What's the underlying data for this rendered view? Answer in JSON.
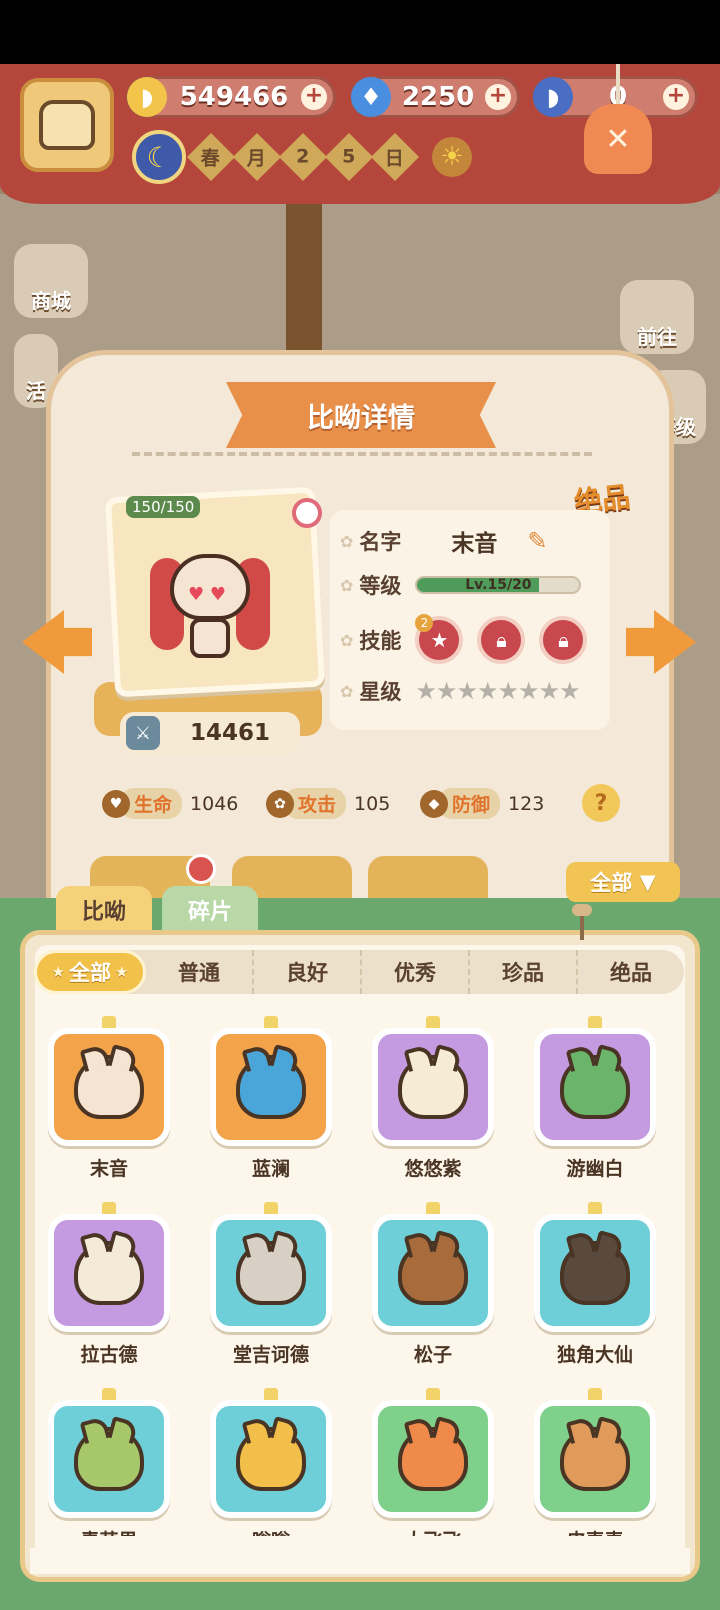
{
  "resources": [
    {
      "icon": "banana-icon",
      "value": "549466",
      "color": "#f2c44a"
    },
    {
      "icon": "blue-flame-icon",
      "value": "2250",
      "color": "#4a8ee0"
    },
    {
      "icon": "blue-banana-icon",
      "value": "0",
      "color": "#4a6ec4"
    }
  ],
  "date": {
    "chars": [
      "春",
      "月",
      "2",
      "5",
      "日"
    ]
  },
  "side_menu": [
    {
      "label": "商城"
    },
    {
      "label": "活"
    },
    {
      "label": "前往"
    },
    {
      "label": "等级"
    }
  ],
  "detail": {
    "title": "比呦详情",
    "quality": "绝品",
    "hp_badge": "150/150",
    "power": "14461",
    "name_label": "名字",
    "name": "末音",
    "level_label": "等级",
    "level_text": "Lv.15/20",
    "level_progress": 0.75,
    "skill_label": "技能",
    "skill_badge": "2",
    "star_label": "星级",
    "stars_total": 8,
    "stats": [
      {
        "icon": "heart-icon",
        "label": "生命",
        "value": "1046"
      },
      {
        "icon": "paw-icon",
        "label": "攻击",
        "value": "105"
      },
      {
        "icon": "shield-icon",
        "label": "防御",
        "value": "123"
      }
    ],
    "help": "?"
  },
  "filter": {
    "label": "全部"
  },
  "tabs": [
    {
      "label": "比呦",
      "active": true
    },
    {
      "label": "碎片",
      "active": false
    }
  ],
  "quality_filters": [
    {
      "label": "全部",
      "active": true
    },
    {
      "label": "普通"
    },
    {
      "label": "良好"
    },
    {
      "label": "优秀"
    },
    {
      "label": "珍品"
    },
    {
      "label": "绝品"
    }
  ],
  "characters": [
    {
      "name": "末音",
      "bg": "#f3a34a",
      "color": "#f6e4d2"
    },
    {
      "name": "蓝澜",
      "bg": "#f3a34a",
      "color": "#4aa6d8"
    },
    {
      "name": "悠悠紫",
      "bg": "#c49ae0",
      "color": "#f6ecd6"
    },
    {
      "name": "游幽白",
      "bg": "#c49ae0",
      "color": "#6bb56a"
    },
    {
      "name": "拉古德",
      "bg": "#c49ae0",
      "color": "#f3ead8"
    },
    {
      "name": "堂吉诃德",
      "bg": "#6fcfd8",
      "color": "#d8d0c4"
    },
    {
      "name": "松子",
      "bg": "#6fcfd8",
      "color": "#a86c3c"
    },
    {
      "name": "独角大仙",
      "bg": "#6fcfd8",
      "color": "#5a4a3e"
    },
    {
      "name": "青苹果",
      "bg": "#6fcfd8",
      "color": "#a6c86a"
    },
    {
      "name": "嗡嗡",
      "bg": "#6fcfd8",
      "color": "#f2c04a"
    },
    {
      "name": "大飞飞",
      "bg": "#7fd08a",
      "color": "#f08a4a"
    },
    {
      "name": "皮麦麦",
      "bg": "#7fd08a",
      "color": "#e09a5a"
    }
  ]
}
